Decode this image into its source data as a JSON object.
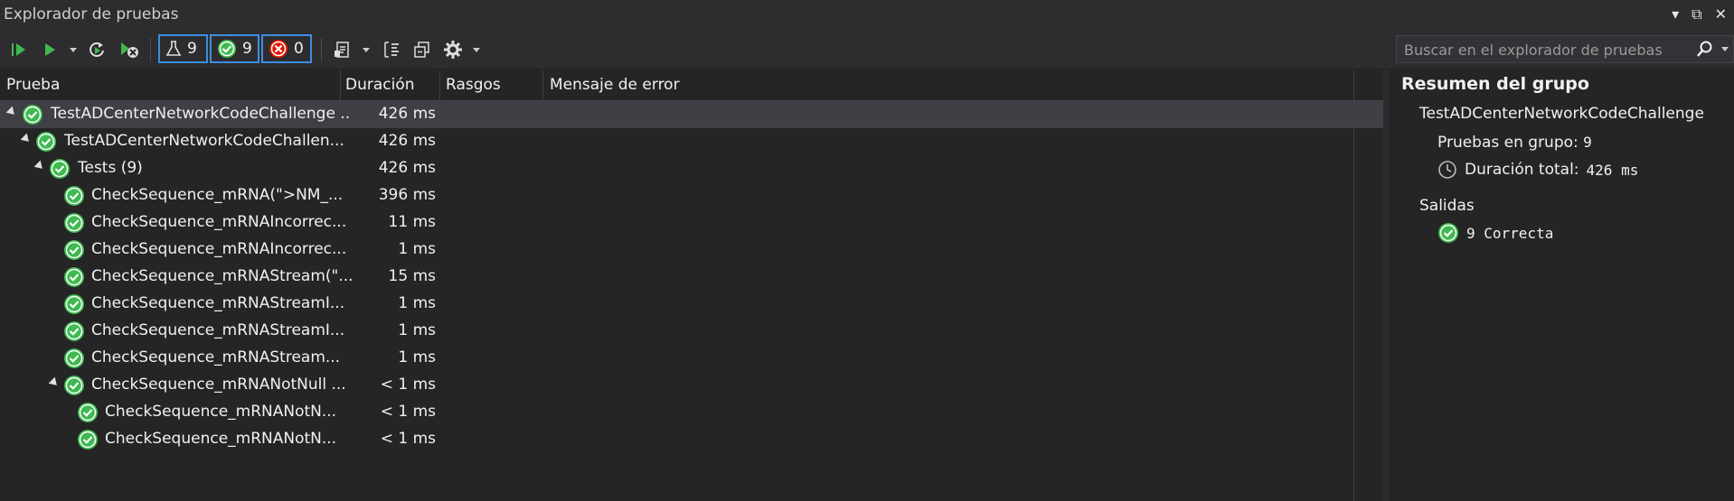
{
  "window": {
    "title": "Explorador de pruebas",
    "buttons": {
      "dropdown": "▾",
      "restore": "⧉",
      "close": "✕"
    }
  },
  "toolbar": {
    "counters": {
      "total": "9",
      "passed": "9",
      "failed": "0"
    },
    "colors": {
      "run": "#3fb950",
      "accent": "#3c8ee0",
      "passed": "#3fb950",
      "failed": "#e51400"
    }
  },
  "search": {
    "placeholder": "Buscar en el explorador de pruebas"
  },
  "columns": {
    "test": "Prueba",
    "duration": "Duración",
    "traits": "Rasgos",
    "error": "Mensaje de error"
  },
  "rows": [
    {
      "name": "TestADCenterNetworkCodeChallenge ..",
      "duration": "426 ms"
    },
    {
      "name": "TestADCenterNetworkCodeChallen...",
      "duration": "426 ms"
    },
    {
      "name": "Tests  (9)",
      "duration": "426 ms"
    },
    {
      "name": "CheckSequence_mRNA(\">NM_...",
      "duration": "396 ms"
    },
    {
      "name": "CheckSequence_mRNAIncorrec...",
      "duration": "11 ms"
    },
    {
      "name": "CheckSequence_mRNAIncorrec...",
      "duration": "1 ms"
    },
    {
      "name": "CheckSequence_mRNAStream(\"...",
      "duration": "15 ms"
    },
    {
      "name": "CheckSequence_mRNAStreamI...",
      "duration": "1 ms"
    },
    {
      "name": "CheckSequence_mRNAStreamI...",
      "duration": "1 ms"
    },
    {
      "name": "CheckSequence_mRNAStream...",
      "duration": "1 ms"
    },
    {
      "name": "CheckSequence_mRNANotNull ...",
      "duration": "< 1 ms"
    },
    {
      "name": "CheckSequence_mRNANotN...",
      "duration": "< 1 ms"
    },
    {
      "name": "CheckSequence_mRNANotN...",
      "duration": "< 1 ms"
    }
  ],
  "summary": {
    "title": "Resumen del grupo",
    "group_name": "TestADCenterNetworkCodeChallenge",
    "count_label": "Pruebas en grupo:",
    "count_value": "9",
    "duration_label": "Duración total:",
    "duration_value": "426 ms",
    "outputs_label": "Salidas",
    "passed_text": "9 Correcta"
  }
}
